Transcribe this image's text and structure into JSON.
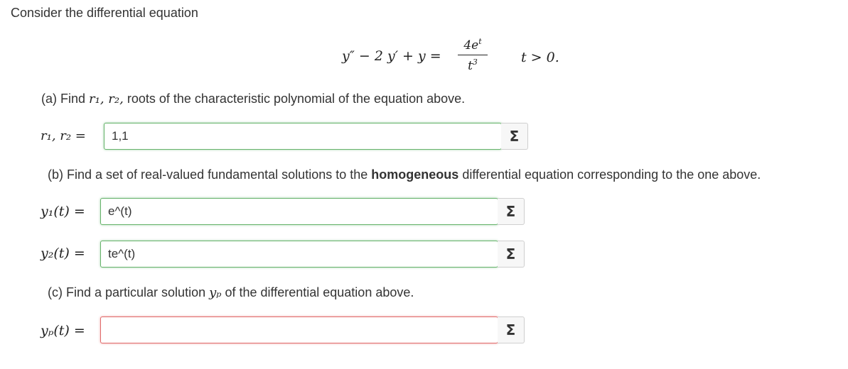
{
  "intro": "Consider the differential equation",
  "equation": {
    "lhs": "y″ − 2 y′ + y =",
    "numerator_base": "4e",
    "numerator_exp": "t",
    "denominator_base": "t",
    "denominator_exp": "3",
    "domain": "t > 0."
  },
  "part_a": {
    "prompt_prefix": "(a) Find",
    "prompt_vars": "r₁, r₂,",
    "prompt_suffix": "roots of the characteristic polynomial of the equation above.",
    "label": "r₁, r₂ =",
    "answer": "1,1",
    "sigma": "Σ"
  },
  "part_b": {
    "prompt_prefix": "(b) Find a set of real-valued fundamental solutions to the",
    "prompt_bold": "homogeneous",
    "prompt_suffix": "differential equation corresponding to the one above.",
    "y1_label": "y₁(t) =",
    "y1_answer": "e^(t)",
    "y2_label": "y₂(t) =",
    "y2_answer": "te^(t)",
    "sigma": "Σ"
  },
  "part_c": {
    "prompt_prefix": "(c) Find a particular solution",
    "prompt_var": "yₚ",
    "prompt_suffix": "of the differential equation above.",
    "yp_label": "yₚ(t) =",
    "yp_answer": "",
    "sigma": "Σ"
  }
}
